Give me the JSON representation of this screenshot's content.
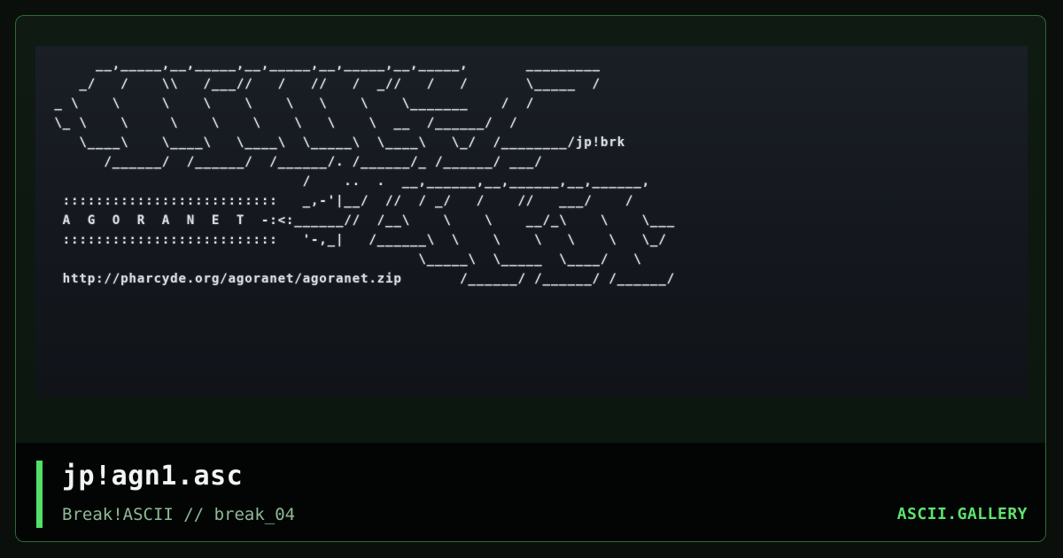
{
  "artwork": {
    "lines": [
      "      __,_____,__,_____,__,_____,__,_____,__,_____,       _________",
      "    _/   /    \\\\   /___//   /   //   /  _//   /   /       \\_____  /",
      " _ \\    \\     \\    \\    \\    \\   \\    \\    \\_______    /  /",
      " \\_ \\    \\     \\    \\    \\    \\   \\    \\  __  /______/  /",
      "    \\____\\    \\____\\   \\____\\  \\_____\\  \\____\\   \\_/  /________/jp!brk",
      "       /______/  /______/  /______/. /______/_ /______/ ___/",
      "                               /    ..  .  __,______,__,______,__,______,",
      "  ::::::::::::::::::::::::::   _,-'|__/  //  / _/   /    //   ___/    /",
      "  A  G  O  R  A  N  E  T  -:<:______//  /__\\    \\    \\    __/_\\    \\    \\___",
      "  ::::::::::::::::::::::::::   '-,_|   /______\\  \\    \\    \\   \\    \\   \\_/",
      "                                             \\_____\\  \\_____  \\____/   \\",
      "  http://pharcyde.org/agoranet/agoranet.zip       /______/ /______/ /______/"
    ]
  },
  "footer": {
    "title": "jp!agn1.asc",
    "subtitle": "Break!ASCII // break_04",
    "brand": "ASCII.GALLERY"
  },
  "colors": {
    "accent": "#52e06a",
    "frame_border": "#2f6a33",
    "background": "#0b0f0c"
  }
}
